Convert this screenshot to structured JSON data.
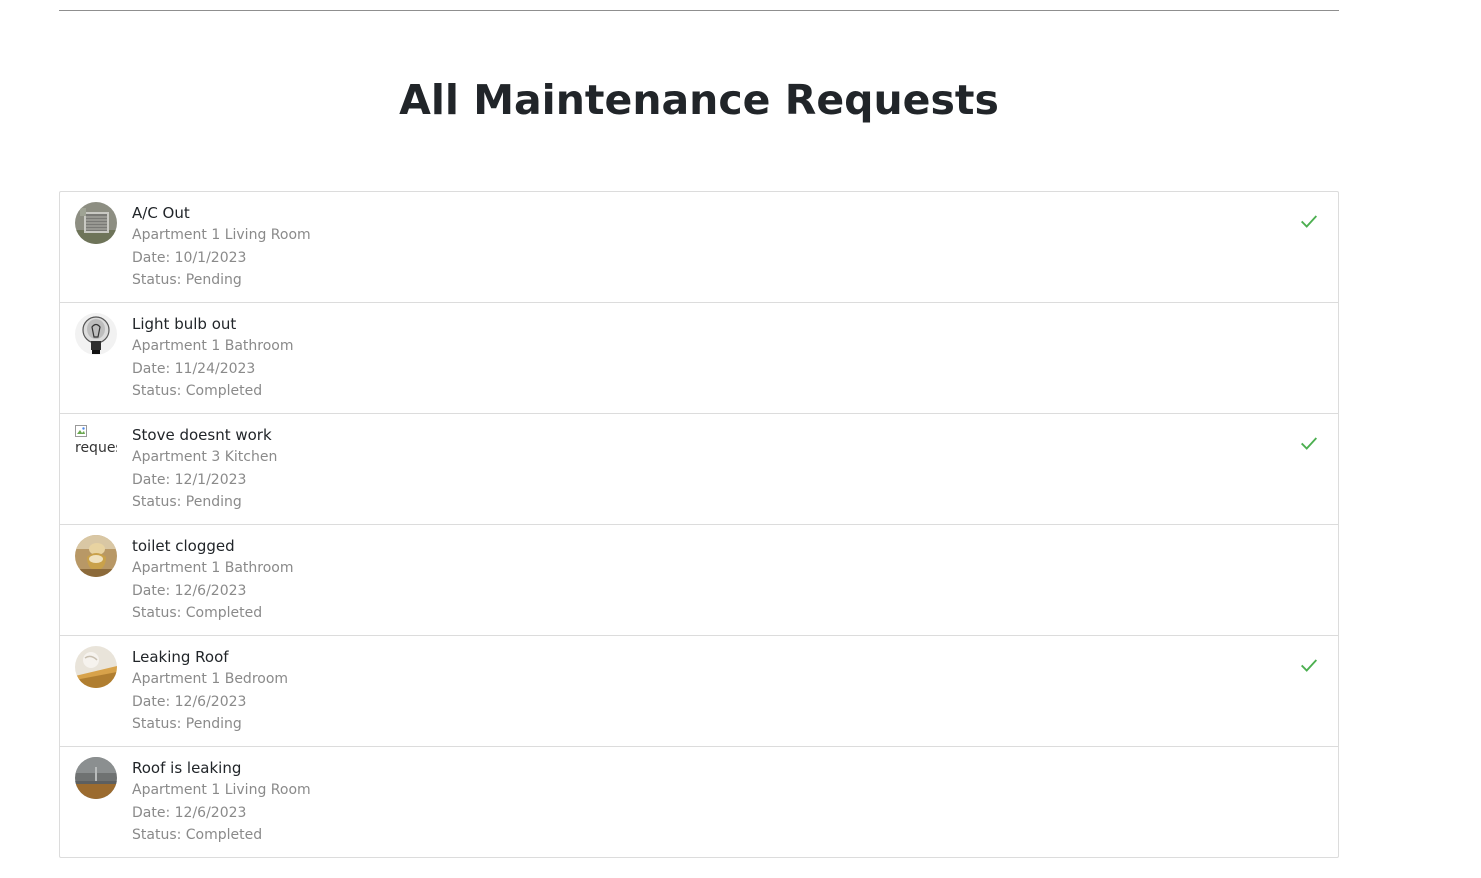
{
  "page": {
    "title": "All Maintenance Requests"
  },
  "requests": [
    {
      "title": "A/C Out",
      "location": "Apartment 1 Living Room",
      "date": "Date: 10/1/2023",
      "status": "Status: Pending",
      "image": "ac-unit",
      "show_check": true
    },
    {
      "title": "Light bulb out",
      "location": "Apartment 1 Bathroom",
      "date": "Date: 11/24/2023",
      "status": "Status: Completed",
      "image": "light-bulb",
      "show_check": false
    },
    {
      "title": "Stove doesnt work",
      "location": "Apartment 3 Kitchen",
      "date": "Date: 12/1/2023",
      "status": "Status: Pending",
      "image": "broken-image",
      "image_alt": "request",
      "show_check": true
    },
    {
      "title": "toilet clogged",
      "location": "Apartment 1 Bathroom",
      "date": "Date: 12/6/2023",
      "status": "Status: Completed",
      "image": "toilet",
      "show_check": false
    },
    {
      "title": "Leaking Roof",
      "location": "Apartment 1 Bedroom",
      "date": "Date: 12/6/2023",
      "status": "Status: Pending",
      "image": "ceiling",
      "show_check": true
    },
    {
      "title": "Roof is leaking",
      "location": "Apartment 1 Living Room",
      "date": "Date: 12/6/2023",
      "status": "Status: Completed",
      "image": "room",
      "show_check": false
    }
  ],
  "colors": {
    "check": "#4caf50",
    "secondary_text": "#8a8a8a",
    "border": "#dcdcdc"
  },
  "icons": {
    "complete_action": "check-icon"
  }
}
